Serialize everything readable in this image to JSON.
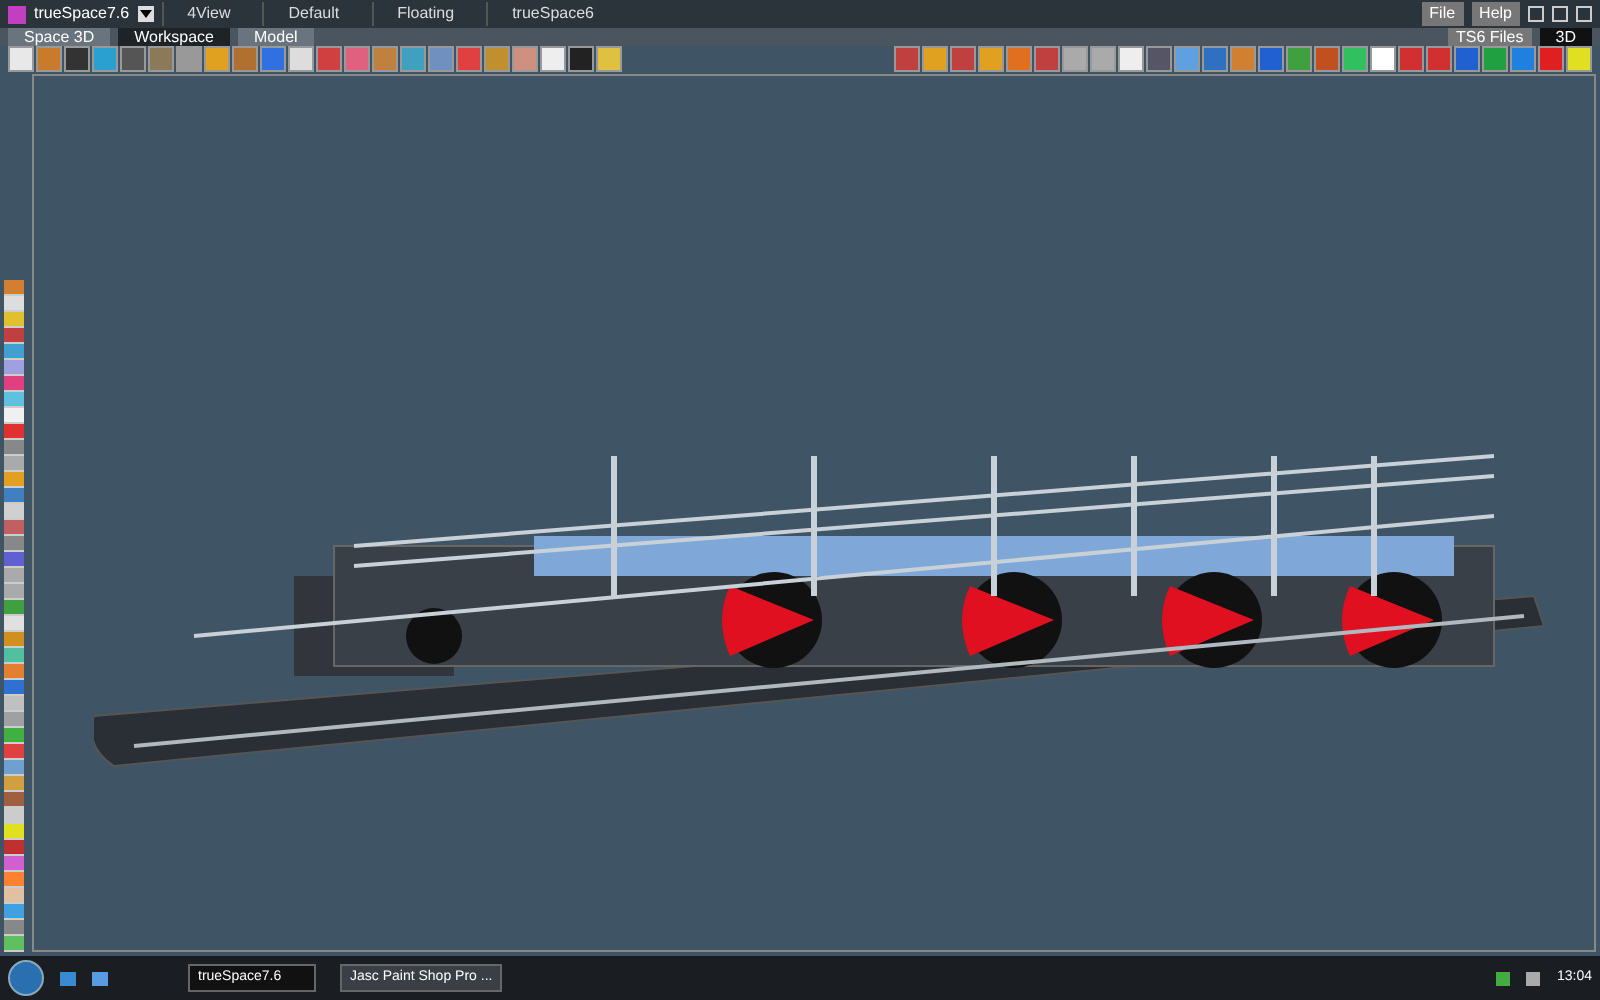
{
  "window": {
    "title": "trueSpace7.6"
  },
  "layouts": [
    {
      "label": "4View"
    },
    {
      "label": "Default"
    },
    {
      "label": "Floating"
    },
    {
      "label": "trueSpace6"
    }
  ],
  "menu": [
    "File",
    "Help"
  ],
  "tabs": [
    {
      "label": "Space 3D",
      "selected": false
    },
    {
      "label": "Workspace",
      "selected": true
    },
    {
      "label": "Model",
      "selected": false
    }
  ],
  "library": {
    "label": "TS6 Files",
    "view": "3D"
  },
  "taskbar": {
    "items": [
      {
        "label": "trueSpace7.6",
        "selected": true
      },
      {
        "label": "Jasc Paint Shop Pro ...",
        "selected": false
      }
    ],
    "clock": "13:04"
  }
}
